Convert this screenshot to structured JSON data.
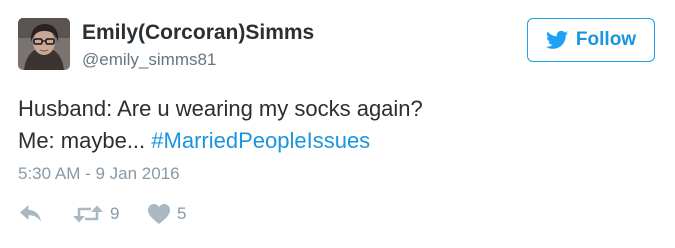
{
  "user": {
    "display_name": "Emily(Corcoran)Simms",
    "handle": "@emily_simms81",
    "avatar_icon": "profile-photo"
  },
  "follow_button": {
    "label": "Follow",
    "icon": "twitter-bird-icon",
    "accent_color": "#1da1f2"
  },
  "tweet": {
    "line1": "Husband: Are u wearing my socks again?",
    "line2_prefix": "Me: maybe... ",
    "hashtag": "#MarriedPeopleIssues",
    "timestamp": "5:30 AM - 9 Jan 2016"
  },
  "actions": {
    "reply_icon": "reply-icon",
    "retweet_icon": "retweet-icon",
    "retweet_count": "9",
    "like_icon": "heart-icon",
    "like_count": "5"
  },
  "colors": {
    "text": "#292f33",
    "muted": "#8899a6",
    "link": "#1b95e0",
    "icon": "#aab8c2"
  }
}
